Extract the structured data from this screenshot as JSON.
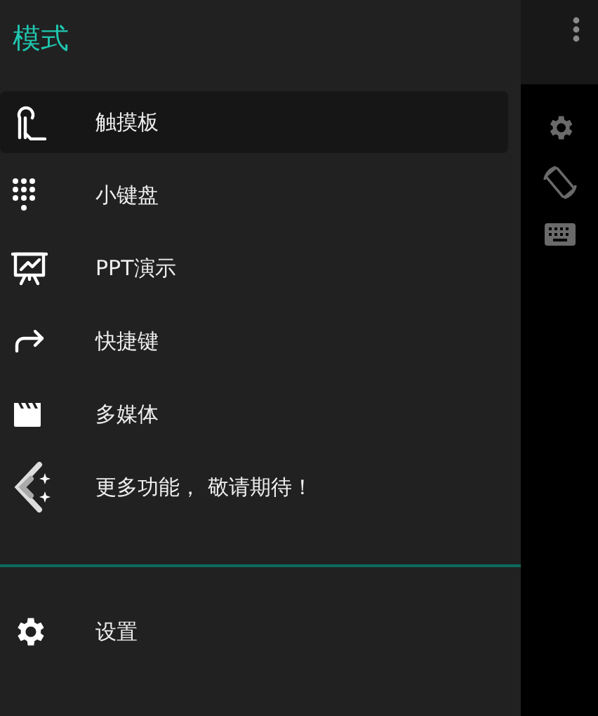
{
  "drawer": {
    "title": "模式",
    "items": [
      {
        "label": "触摸板",
        "kind": "touchpad",
        "selected": true
      },
      {
        "label": "小键盘",
        "kind": "keypad",
        "selected": false
      },
      {
        "label": "PPT演示",
        "kind": "presentation",
        "selected": false
      },
      {
        "label": "快捷键",
        "kind": "shortcut",
        "selected": false
      },
      {
        "label": "多媒体",
        "kind": "media",
        "selected": false
      },
      {
        "label": "更多功能， 敬请期待！",
        "kind": "more",
        "selected": false
      }
    ],
    "footer_items": [
      {
        "label": "设置",
        "kind": "settings",
        "selected": false
      }
    ]
  }
}
